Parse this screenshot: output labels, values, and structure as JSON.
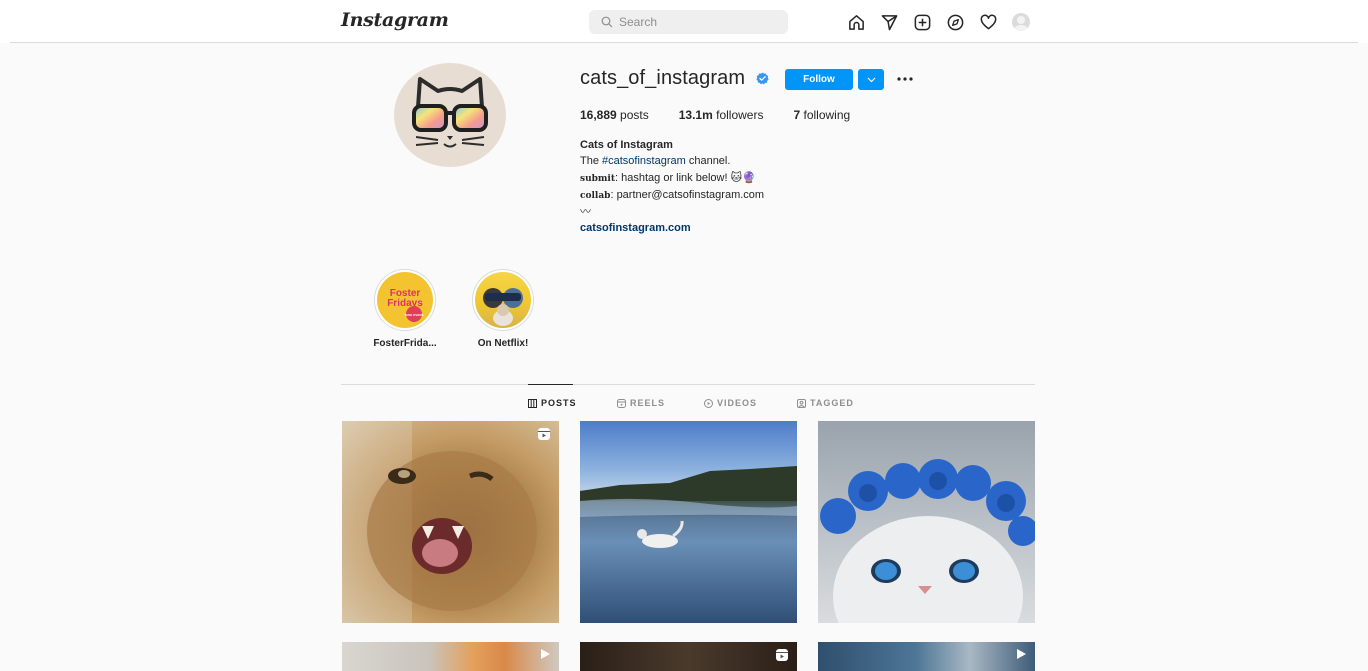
{
  "header": {
    "logo": "Instagram",
    "search_placeholder": "Search",
    "icons": [
      "home-icon",
      "direct-icon",
      "new-post-icon",
      "explore-icon",
      "activity-icon",
      "profile-avatar"
    ]
  },
  "profile": {
    "username": "cats_of_instagram",
    "verified": true,
    "follow_label": "Follow",
    "stats": {
      "posts_count": "16,889",
      "posts_label": "posts",
      "followers_count": "13.1m",
      "followers_label": "followers",
      "following_count": "7",
      "following_label": "following"
    },
    "bio": {
      "name": "Cats of Instagram",
      "line1_prefix": "The ",
      "line1_tag": "#catsofinstagram",
      "line1_suffix": " channel.",
      "line2_bold": "submit",
      "line2_text": ": hashtag or link below! 🐱🔮",
      "line3_bold": "collab",
      "line3_text": ": partner@catsofinstagram.com",
      "line4": "〰",
      "link": "catsofinstagram.com"
    }
  },
  "highlights": [
    {
      "label": "FosterFrida...",
      "cover_text_1": "Foster",
      "cover_text_2": "Fridays",
      "cover_badge": "TAKE OVERS"
    },
    {
      "label": "On Netflix!"
    }
  ],
  "tabs": [
    {
      "label": "POSTS",
      "active": true
    },
    {
      "label": "REELS",
      "active": false
    },
    {
      "label": "VIDEOS",
      "active": false
    },
    {
      "label": "TAGGED",
      "active": false
    }
  ],
  "posts": [
    {
      "type": "reel",
      "icon": "reel-icon"
    },
    {
      "type": "image"
    },
    {
      "type": "image"
    },
    {
      "type": "video",
      "icon": "play-icon"
    },
    {
      "type": "reel",
      "icon": "reel-icon"
    },
    {
      "type": "video",
      "icon": "play-icon"
    }
  ],
  "colors": {
    "accent": "#0095f6",
    "link": "#00376b",
    "border": "#dbdbdb",
    "background": "#fafafa"
  }
}
